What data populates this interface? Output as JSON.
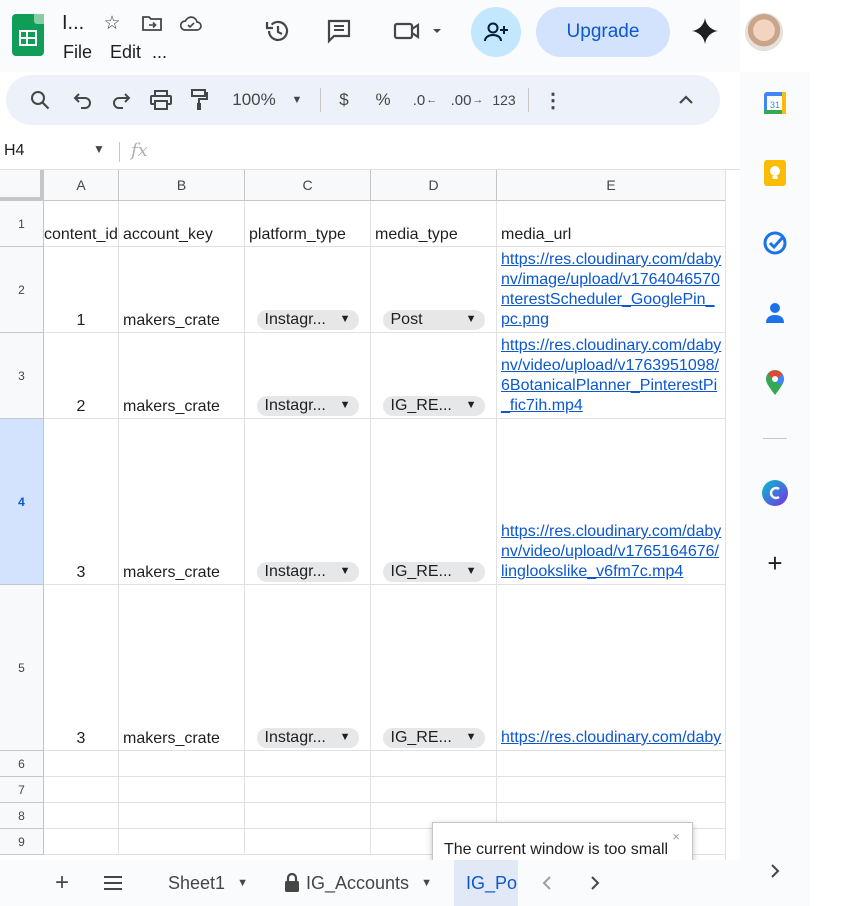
{
  "header": {
    "doc_title": "I...",
    "menus": [
      "File",
      "Edit",
      "..."
    ],
    "upgrade_label": "Upgrade"
  },
  "toolbar": {
    "zoom": "100%",
    "currency": "$",
    "percent": "%",
    "decrease_decimals": ".0",
    "increase_decimals": ".00",
    "number_format": "123"
  },
  "formula_bar": {
    "cell_ref": "H4",
    "fx": "fx"
  },
  "sheet": {
    "columns": [
      "A",
      "B",
      "C",
      "D",
      "E"
    ],
    "rows": [
      "1",
      "2",
      "3",
      "4",
      "5",
      "6",
      "7",
      "8",
      "9"
    ],
    "selected_row": "4",
    "headers": [
      "content_id",
      "account_key",
      "platform_type",
      "media_type",
      "media_url"
    ],
    "data": [
      {
        "content_id": "1",
        "account_key": "makers_crate",
        "platform_type": "Instagr...",
        "media_type": "Post",
        "media_url": [
          "https://res.cloudinary.com/daby",
          "nv/image/upload/v1764046570",
          "nterestScheduler_GooglePin_",
          "pc.png"
        ]
      },
      {
        "content_id": "2",
        "account_key": "makers_crate",
        "platform_type": "Instagr...",
        "media_type": "IG_RE...",
        "media_url": [
          "https://res.cloudinary.com/daby",
          "nv/video/upload/v1763951098/",
          "6BotanicalPlanner_PinterestPi",
          "_fic7ih.mp4"
        ]
      },
      {
        "content_id": "3",
        "account_key": "makers_crate",
        "platform_type": "Instagr...",
        "media_type": "IG_RE...",
        "media_url": [
          "https://res.cloudinary.com/daby",
          "nv/video/upload/v1765164676/",
          "linglookslike_v6fm7c.mp4"
        ]
      },
      {
        "content_id": "3",
        "account_key": "makers_crate",
        "platform_type": "Instagr...",
        "media_type": "IG_RE...",
        "media_url": [
          "https://res.cloudinary.com/daby"
        ]
      }
    ]
  },
  "popup": {
    "message": "The current window is too small",
    "close": "×"
  },
  "tabs": {
    "sheets": [
      "Sheet1",
      "IG_Accounts",
      "IG_Po"
    ],
    "active": "IG_Po"
  },
  "colors": {
    "accent": "#0b57d0",
    "upgrade_bg": "#d3e3fd",
    "share_bg": "#c2e7ff",
    "selected_row_bg": "#d3e3fd",
    "sheets_green": "#0f9d58"
  }
}
